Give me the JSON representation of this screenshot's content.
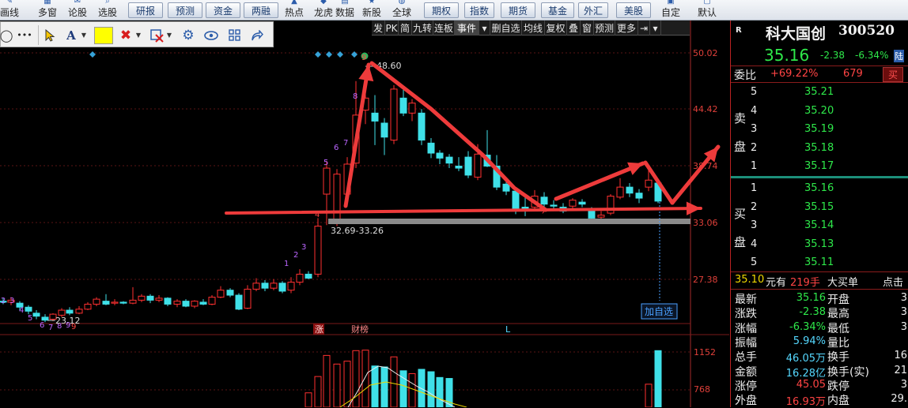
{
  "toolbar": {
    "items": [
      {
        "label": "画线",
        "icon": "pen-icon"
      },
      {
        "label": "多窗",
        "icon": "windows-icon"
      },
      {
        "label": "论股",
        "icon": "chat-icon"
      },
      {
        "label": "选股",
        "icon": "search-icon"
      }
    ],
    "buttons": [
      "研报",
      "预测",
      "资金",
      "两融"
    ],
    "items2": [
      {
        "label": "热点",
        "icon": "fire-icon"
      },
      {
        "label": "龙虎",
        "icon": "dragon-icon"
      },
      {
        "label": "数据",
        "icon": "data-icon"
      },
      {
        "label": "新股",
        "icon": "new-icon"
      },
      {
        "label": "全球",
        "icon": "globe-icon"
      }
    ],
    "buttons2": [
      "期权",
      "指数",
      "期货",
      "基金",
      "外汇",
      "美股"
    ],
    "items3": [
      {
        "label": "自定",
        "icon": "custom-icon"
      },
      {
        "label": "默认",
        "icon": "default-icon"
      }
    ]
  },
  "drawtools": {
    "more": "•••",
    "text_tool": "A"
  },
  "tabs": [
    "发",
    "PK",
    "简",
    "九转",
    "连板",
    "事件",
    "▾",
    "删自选",
    "均线",
    "复权",
    "叠",
    "窗",
    "预测",
    "更多",
    "⇥",
    "▾"
  ],
  "active_tab": 5,
  "chart": {
    "price_axis": [
      "50.02",
      "44.42",
      "38.74",
      "33.06",
      "27.38"
    ],
    "volume_axis": [
      "1152",
      "768"
    ],
    "high_label": "48.60",
    "low_label": "23.12",
    "range_label": "32.69-33.26",
    "add_watch": "加自选",
    "event_zhang": "涨",
    "event_caibang": "财榜",
    "event_l": "L",
    "count_labels": [
      "2",
      "3",
      "4",
      "5",
      "6",
      "7",
      "8",
      "9",
      "1",
      "2",
      "3",
      "4",
      "5",
      "6",
      "7",
      "8",
      "9"
    ],
    "colors": {
      "up": "#ff3030",
      "down": "#3fe0e8",
      "arrow": "#ee3b3b"
    }
  },
  "quote": {
    "r_mark": "R",
    "name": "科大国创",
    "code": "300520",
    "price": "35.16",
    "change": "-2.38",
    "change_pct": "-6.34%",
    "board_badge": "陆",
    "weibi_label": "委比",
    "weibi_pct": "+69.22%",
    "weibi_diff": "679",
    "sell_badge": "买",
    "sell_side_label": [
      "卖",
      "盘"
    ],
    "buy_side_label": [
      "买",
      "盘"
    ],
    "asks": [
      {
        "level": "5",
        "price": "35.21"
      },
      {
        "level": "4",
        "price": "35.20"
      },
      {
        "level": "3",
        "price": "35.19"
      },
      {
        "level": "2",
        "price": "35.18"
      },
      {
        "level": "1",
        "price": "35.17"
      }
    ],
    "bids": [
      {
        "level": "1",
        "price": "35.16"
      },
      {
        "level": "2",
        "price": "35.15"
      },
      {
        "level": "3",
        "price": "35.14"
      },
      {
        "level": "4",
        "price": "35.13"
      },
      {
        "level": "5",
        "price": "35.11"
      }
    ],
    "bigorder": {
      "price": "35.10",
      "unit": "元有",
      "qty": "219手",
      "label": "大买单",
      "link": "点击"
    },
    "stats_left": [
      {
        "label": "最新",
        "value": "35.16",
        "color": "green"
      },
      {
        "label": "涨跌",
        "value": "-2.38",
        "color": "green"
      },
      {
        "label": "涨幅",
        "value": "-6.34%",
        "color": "green"
      },
      {
        "label": "振幅",
        "value": "5.94%",
        "color": "cyan"
      },
      {
        "label": "总手",
        "value": "46.05万",
        "color": "cyan"
      },
      {
        "label": "金额",
        "value": "16.28亿",
        "color": "cyan"
      },
      {
        "label": "涨停",
        "value": "45.05",
        "color": "red"
      },
      {
        "label": "外盘",
        "value": "16.93万",
        "color": "red"
      }
    ],
    "stats_right": [
      {
        "label": "开盘",
        "value": "3"
      },
      {
        "label": "最高",
        "value": "3"
      },
      {
        "label": "最低",
        "value": "3"
      },
      {
        "label": "量比",
        "value": ""
      },
      {
        "label": "换手",
        "value": "16"
      },
      {
        "label": "换手(实)",
        "value": "21"
      },
      {
        "label": "跌停",
        "value": "3"
      },
      {
        "label": "内盘",
        "value": "29."
      }
    ]
  }
}
